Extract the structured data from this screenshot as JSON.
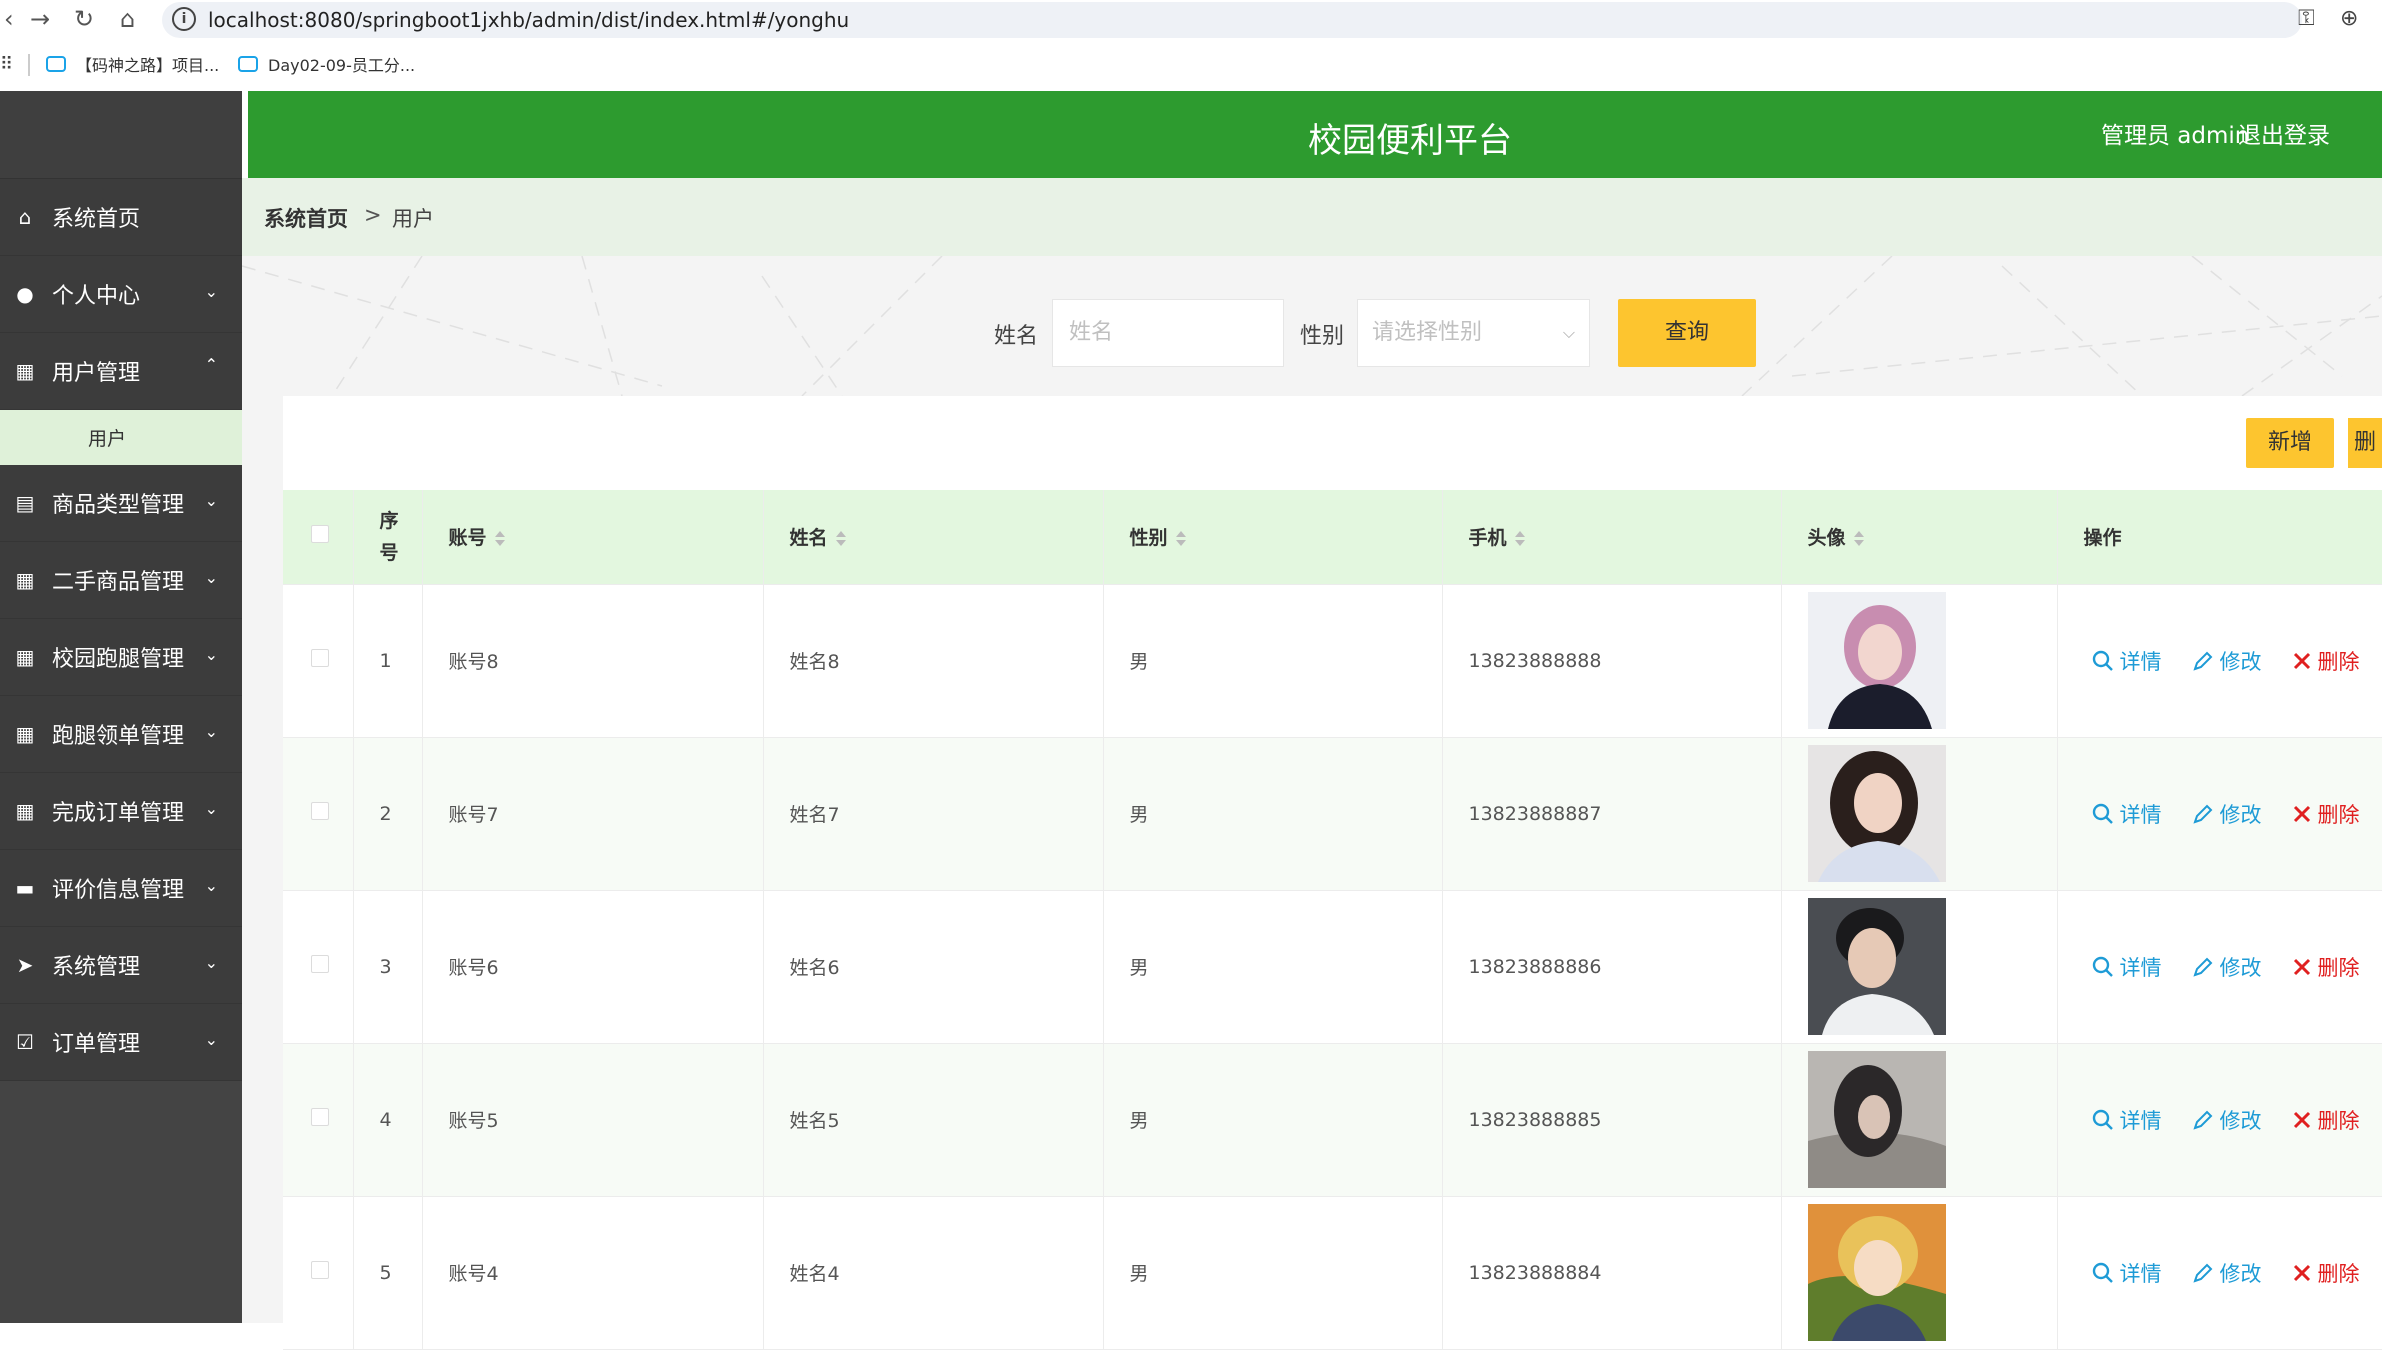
{
  "browser": {
    "url": "localhost:8080/springboot1jxhb/admin/dist/index.html#/yonghu",
    "bookmarks": [
      "【码神之路】项目...",
      "Day02-09-员工分..."
    ]
  },
  "header": {
    "title": "校园便利平台",
    "user": "管理员 admin",
    "logout": "退出登录"
  },
  "sidebar": {
    "items": [
      {
        "label": "系统首页",
        "icon": "home-icon"
      },
      {
        "label": "个人中心",
        "icon": "user-icon",
        "arrow": "down"
      },
      {
        "label": "用户管理",
        "icon": "grid-icon",
        "arrow": "up"
      },
      {
        "label": "商品类型管理",
        "icon": "clipboard-icon",
        "arrow": "down"
      },
      {
        "label": "二手商品管理",
        "icon": "grid-icon",
        "arrow": "down"
      },
      {
        "label": "校园跑腿管理",
        "icon": "grid-icon",
        "arrow": "down"
      },
      {
        "label": "跑腿领单管理",
        "icon": "grid-icon",
        "arrow": "down"
      },
      {
        "label": "完成订单管理",
        "icon": "grid-icon",
        "arrow": "down"
      },
      {
        "label": "评价信息管理",
        "icon": "comment-icon",
        "arrow": "down"
      },
      {
        "label": "系统管理",
        "icon": "send-icon",
        "arrow": "down"
      },
      {
        "label": "订单管理",
        "icon": "clipboard-check-icon",
        "arrow": "down"
      }
    ],
    "submenu_user": "用户"
  },
  "breadcrumb": {
    "home": "系统首页",
    "sep": ">",
    "current": "用户"
  },
  "search": {
    "name_label": "姓名",
    "name_placeholder": "姓名",
    "gender_label": "性别",
    "gender_placeholder": "请选择性别",
    "button": "查询"
  },
  "actions": {
    "add": "新增",
    "delete": "删除"
  },
  "table": {
    "headers": {
      "index": "序号",
      "account": "账号",
      "name": "姓名",
      "gender": "性别",
      "phone": "手机",
      "avatar": "头像",
      "ops": "操作"
    },
    "ops": {
      "detail": "详情",
      "edit": "修改",
      "delete": "删除"
    },
    "rows": [
      {
        "index": "1",
        "account": "账号8",
        "name": "姓名8",
        "gender": "男",
        "phone": "13823888888"
      },
      {
        "index": "2",
        "account": "账号7",
        "name": "姓名7",
        "gender": "男",
        "phone": "13823888887"
      },
      {
        "index": "3",
        "account": "账号6",
        "name": "姓名6",
        "gender": "男",
        "phone": "13823888886"
      },
      {
        "index": "4",
        "account": "账号5",
        "name": "姓名5",
        "gender": "男",
        "phone": "13823888885"
      },
      {
        "index": "5",
        "account": "账号4",
        "name": "姓名4",
        "gender": "男",
        "phone": "13823888884"
      }
    ]
  },
  "colors": {
    "header": "#2d9b2f",
    "sidebar": "#444444",
    "accent_button": "#fdc52f",
    "table_header": "#e3f7df",
    "link_blue": "#1e9bd6",
    "delete_red": "#e02020"
  }
}
